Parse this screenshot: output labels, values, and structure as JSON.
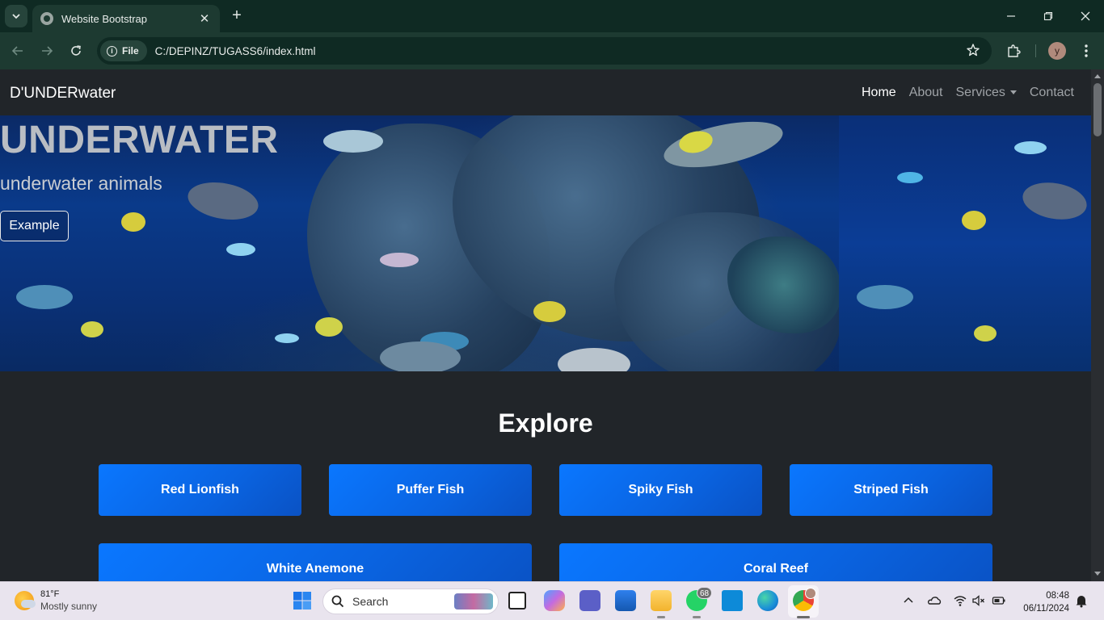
{
  "browser": {
    "tab_title": "Website Bootstrap",
    "new_tab_symbol": "+",
    "close_symbol": "✕",
    "site_chip": "File",
    "url": "C:/DEPINZ/TUGASS6/index.html",
    "profile_initial": "y"
  },
  "navbar": {
    "brand": "D'UNDERwater",
    "links": [
      "Home",
      "About",
      "Services",
      "Contact"
    ],
    "active": "Home"
  },
  "hero": {
    "title": "UNDERWATER",
    "subtitle": "underwater animals",
    "button": "Example"
  },
  "section": {
    "heading": "Explore",
    "cards": [
      "Red Lionfish",
      "Puffer Fish",
      "Spiky Fish",
      "Striped Fish",
      "White Anemone",
      "Coral Reef"
    ]
  },
  "taskbar": {
    "weather_temp": "81°F",
    "weather_desc": "Mostly sunny",
    "search_label": "Search",
    "whatsapp_badge": "68",
    "time": "08:48",
    "date": "06/11/2024"
  },
  "colors": {
    "browser_frame": "#0f2a23",
    "toolbar": "#1d3a31",
    "page_bg": "#212529",
    "card_blue": "#0a77ff",
    "hero_water": "#0a3a8a"
  }
}
